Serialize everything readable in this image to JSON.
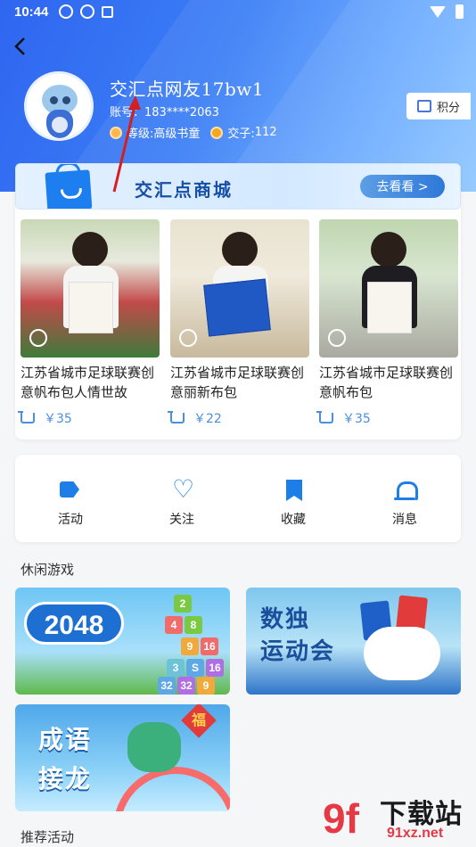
{
  "status_bar": {
    "time": "10:44"
  },
  "profile": {
    "nickname": "交汇点网友17bw1",
    "account_label": "账号：",
    "account_value": "183****2063",
    "level_label": "等级:",
    "level_value": "高级书童",
    "coin_label": "交子:",
    "coin_value": "112"
  },
  "points_button": {
    "label": "积分"
  },
  "mall": {
    "title": "交汇点商城",
    "go_button": "去看看 >"
  },
  "products": [
    {
      "name": "江苏省城市足球联赛创意帆布包人情世故",
      "price": "￥35"
    },
    {
      "name": "江苏省城市足球联赛创意丽新布包",
      "price": "￥22"
    },
    {
      "name": "江苏省城市足球联赛创意帆布包",
      "price": "￥35"
    }
  ],
  "quick_actions": [
    {
      "label": "活动",
      "icon": "tag-icon"
    },
    {
      "label": "关注",
      "icon": "heart-plus-icon"
    },
    {
      "label": "收藏",
      "icon": "bookmark-star-icon"
    },
    {
      "label": "消息",
      "icon": "bell-icon"
    }
  ],
  "sections": {
    "games_title": "休闲游戏",
    "recommend_title": "推荐活动"
  },
  "games": [
    {
      "title": "2048",
      "tiles": [
        "2",
        "4",
        "8",
        "9",
        "16",
        "3",
        "S",
        "16",
        "32",
        "32",
        "9"
      ]
    },
    {
      "title_line1": "数独",
      "title_line2": "运动会"
    },
    {
      "title_line1": "成语",
      "title_line2": "接龙",
      "badge": "福"
    }
  ],
  "watermark": {
    "logo": "9f",
    "title": "下载站",
    "url": "91xz.net"
  },
  "colors": {
    "header_start": "#2f66f0",
    "header_end": "#86c3ff",
    "accent": "#1e7ee8",
    "price": "#4a8fe0"
  }
}
